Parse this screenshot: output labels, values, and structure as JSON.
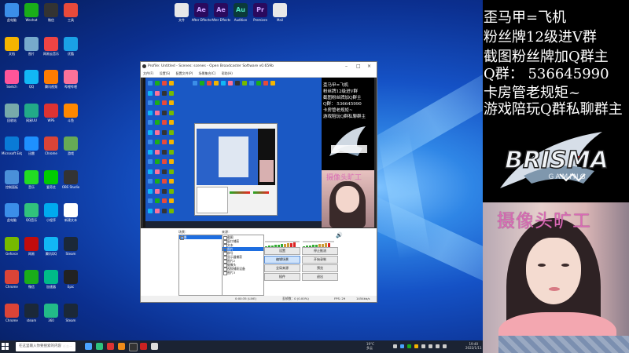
{
  "desktop": {
    "icons": [
      {
        "label": "此电脑"
      },
      {
        "label": "Wechat"
      },
      {
        "label": "微信"
      },
      {
        "label": "工具"
      },
      {
        "label": "文档"
      },
      {
        "label": "图片"
      },
      {
        "label": "网易云音乐"
      },
      {
        "label": "优酷"
      },
      {
        "label": "Sketch"
      },
      {
        "label": "QQ"
      },
      {
        "label": "腾讯视频"
      },
      {
        "label": "哔哩哔哩"
      },
      {
        "label": "回收站"
      },
      {
        "label": "网易UU"
      },
      {
        "label": "WPS"
      },
      {
        "label": "斗鱼"
      },
      {
        "label": "Microsoft Edge"
      },
      {
        "label": "迅雷"
      },
      {
        "label": "Chrome"
      },
      {
        "label": "游戏"
      },
      {
        "label": "控制面板"
      },
      {
        "label": "音乐"
      },
      {
        "label": "爱奇艺"
      },
      {
        "label": "OBS Studio"
      },
      {
        "label": "此电脑"
      },
      {
        "label": "QQ音乐"
      },
      {
        "label": "小程序"
      },
      {
        "label": "新建文本"
      },
      {
        "label": "Geforce"
      },
      {
        "label": "网易"
      },
      {
        "label": "腾讯QQ"
      },
      {
        "label": "Steam"
      },
      {
        "label": "Chrome"
      },
      {
        "label": "微信"
      },
      {
        "label": "加速器"
      },
      {
        "label": "Epic"
      },
      {
        "label": "Chrome"
      },
      {
        "label": "steam"
      },
      {
        "label": "360"
      },
      {
        "label": "Steam"
      }
    ],
    "top_icons": [
      {
        "label": "文件"
      },
      {
        "label": "After Effects"
      },
      {
        "label": "After Effects"
      },
      {
        "label": "Audition"
      },
      {
        "label": "Premiere"
      },
      {
        "label": "Mail"
      }
    ]
  },
  "taskbar": {
    "search_placeholder": "在这里输入你要搜索的内容",
    "task_label": "任务一",
    "weather": "19°C",
    "weather_sub": "多云",
    "time": "19:40",
    "date": "2022/1/11",
    "colors": {
      "bg": "#1b2333"
    }
  },
  "obs": {
    "title": "Profile: Untitled - Scenes: scenes - Open Broadcaster Software v0.659b",
    "menu": [
      "文件(F)",
      "设置(S)",
      "配置文件(P)",
      "场景集合(C)",
      "帮助(H)"
    ],
    "scenes_header": "场景：",
    "sources_header": "来源：",
    "scenes": [
      "场景"
    ],
    "sources": [
      {
        "label": "截图",
        "selected": false
      },
      {
        "label": "窗口捕获",
        "selected": false
      },
      {
        "label": "文本",
        "selected": false
      },
      {
        "label": "图片",
        "selected": true
      },
      {
        "label": "群号",
        "selected": false
      },
      {
        "label": "显示器捕获",
        "selected": false
      },
      {
        "label": "图片2",
        "selected": false
      },
      {
        "label": "摄像头",
        "selected": false
      },
      {
        "label": "视频捕获设备",
        "selected": false
      },
      {
        "label": "图片3",
        "selected": false
      }
    ],
    "buttons": {
      "settings": "设置",
      "stop_stream": "停止推流",
      "edit_scene": "编辑场景",
      "start_record": "开始录制",
      "global_sources": "全局来源",
      "preview": "预览",
      "plugins": "插件",
      "exit": "退出"
    },
    "status": {
      "time": "0:00:35 (LIVE)",
      "dropped": "丢帧数：0 (0.00%)",
      "fps": "FPS: 29",
      "bitrate": "1454kb/s"
    }
  },
  "overlay": {
    "lines": [
      "歪马甲=飞机",
      "粉丝牌12级进V群",
      "截图粉丝牌加Q群主",
      "Q群： 536645990",
      "卡房管老规矩~",
      "游戏陪玩Q群私聊群主"
    ],
    "logo_text": "BRISMA",
    "logo_sub": "GAMING",
    "camera_label": "摄像头旷工",
    "colors": {
      "text": "#ffffff",
      "camera_label": "#d96bb5",
      "logo": "#e8eef5"
    }
  }
}
